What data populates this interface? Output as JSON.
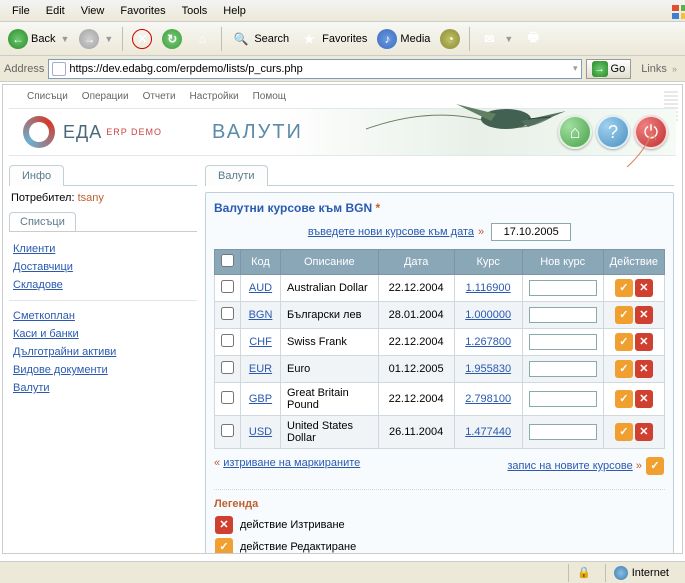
{
  "browser": {
    "menu": {
      "file": "File",
      "edit": "Edit",
      "view": "View",
      "favorites": "Favorites",
      "tools": "Tools",
      "help": "Help"
    },
    "toolbar": {
      "back": "Back",
      "search": "Search",
      "favorites": "Favorites",
      "media": "Media"
    },
    "address_label": "Address",
    "url": "https://dev.edabg.com/erpdemo/lists/p_curs.php",
    "go": "Go",
    "links": "Links"
  },
  "app": {
    "topnav": {
      "lists": "Списъци",
      "operations": "Операции",
      "reports": "Отчети",
      "settings": "Настройки",
      "help": "Помощ"
    },
    "brand": "ЕДА",
    "brand_sub": "ERP DEMO",
    "page_title": "ВАЛУТИ"
  },
  "sidebar": {
    "info_tab": "Инфо",
    "user_label": "Потребител:",
    "user_name": "tsany",
    "lists_tab": "Списъци",
    "links": {
      "clients": "Клиенти",
      "suppliers": "Доставчици",
      "warehouses": "Складове",
      "chart_of_accounts": "Сметкоплан",
      "cash_and_banks": "Каси и банки",
      "fixed_assets": "Дълготрайни активи",
      "doc_types": "Видове документи",
      "currencies": "Валути"
    }
  },
  "main": {
    "tab": "Валути",
    "panel_title": "Валутни курсове към BGN",
    "date_prompt": "въведете нови курсове към дата",
    "date_value": "17.10.2005",
    "columns": {
      "code": "Код",
      "desc": "Описание",
      "date": "Дата",
      "rate": "Курс",
      "newrate": "Нов курс",
      "action": "Действие"
    },
    "rows": [
      {
        "code": "AUD",
        "desc": "Australian Dollar",
        "date": "22.12.2004",
        "rate": "1.116900"
      },
      {
        "code": "BGN",
        "desc": "Български лев",
        "date": "28.01.2004",
        "rate": "1.000000"
      },
      {
        "code": "CHF",
        "desc": "Swiss Frank",
        "date": "22.12.2004",
        "rate": "1.267800"
      },
      {
        "code": "EUR",
        "desc": "Euro",
        "date": "01.12.2005",
        "rate": "1.955830"
      },
      {
        "code": "GBP",
        "desc": "Great Britain Pound",
        "date": "22.12.2004",
        "rate": "2.798100"
      },
      {
        "code": "USD",
        "desc": "United States Dollar",
        "date": "26.11.2004",
        "rate": "1.477440"
      }
    ],
    "footer": {
      "delete_marked": "изтриване на маркираните",
      "save_rates": "запис на новите курсове"
    },
    "legend": {
      "title": "Легенда",
      "delete": "действие Изтриване",
      "edit": "действие Редактиране"
    }
  },
  "status": {
    "zone": "Internet"
  }
}
